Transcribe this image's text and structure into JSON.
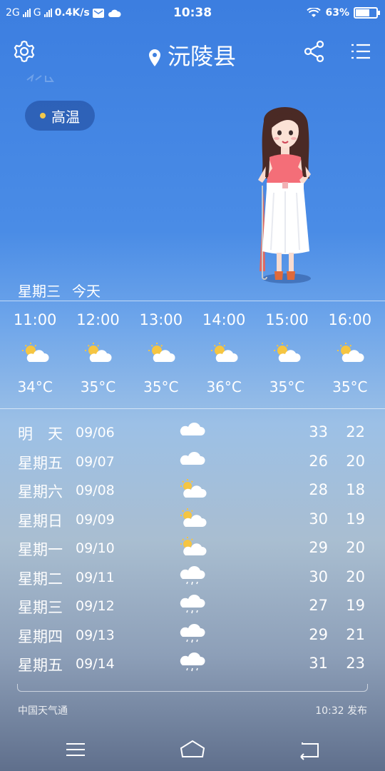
{
  "status_bar": {
    "network1": "2G",
    "network2": "G",
    "speed": "0.4K/s",
    "time": "10:38",
    "battery_pct": "63%",
    "battery_level": 0.63
  },
  "header": {
    "city": "沅陵县"
  },
  "alert": {
    "label": "高温",
    "dot_color": "#f2c84b"
  },
  "today": {
    "weekday": "星期三",
    "label": "今天"
  },
  "hourly": [
    {
      "time": "11:00",
      "icon": "partly-cloudy-icon",
      "temp": "34°C"
    },
    {
      "time": "12:00",
      "icon": "partly-cloudy-icon",
      "temp": "35°C"
    },
    {
      "time": "13:00",
      "icon": "partly-cloudy-icon",
      "temp": "35°C"
    },
    {
      "time": "14:00",
      "icon": "partly-cloudy-icon",
      "temp": "36°C"
    },
    {
      "time": "15:00",
      "icon": "partly-cloudy-icon",
      "temp": "35°C"
    },
    {
      "time": "16:00",
      "icon": "partly-cloudy-icon",
      "temp": "35°C"
    }
  ],
  "daily": [
    {
      "weekday": "明　天",
      "date": "09/06",
      "icon": "cloudy-icon",
      "high": "33",
      "low": "22"
    },
    {
      "weekday": "星期五",
      "date": "09/07",
      "icon": "cloudy-icon",
      "high": "26",
      "low": "20"
    },
    {
      "weekday": "星期六",
      "date": "09/08",
      "icon": "partly-cloudy-icon",
      "high": "28",
      "low": "18"
    },
    {
      "weekday": "星期日",
      "date": "09/09",
      "icon": "partly-cloudy-icon",
      "high": "30",
      "low": "19"
    },
    {
      "weekday": "星期一",
      "date": "09/10",
      "icon": "partly-cloudy-icon",
      "high": "29",
      "low": "20"
    },
    {
      "weekday": "星期二",
      "date": "09/11",
      "icon": "rain-icon",
      "high": "30",
      "low": "20"
    },
    {
      "weekday": "星期三",
      "date": "09/12",
      "icon": "rain-icon",
      "high": "27",
      "low": "19"
    },
    {
      "weekday": "星期四",
      "date": "09/13",
      "icon": "rain-icon",
      "high": "29",
      "low": "21"
    },
    {
      "weekday": "星期五",
      "date": "09/14",
      "icon": "rain-icon",
      "high": "31",
      "low": "23"
    }
  ],
  "footer": {
    "source": "中国天气通",
    "published": "10:32 发布"
  }
}
